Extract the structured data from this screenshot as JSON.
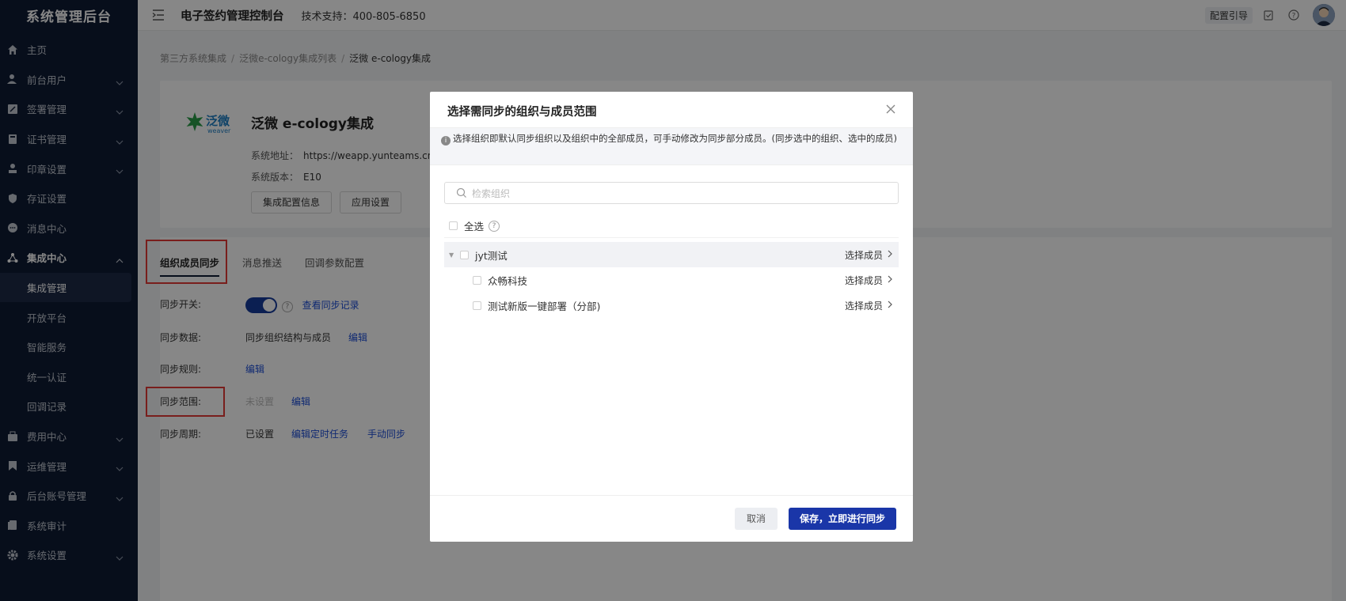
{
  "sidebar": {
    "brand": "系统管理后台",
    "items": [
      {
        "label": "主页",
        "icon": "home-icon",
        "chevron": false
      },
      {
        "label": "前台用户",
        "icon": "user-icon",
        "chevron": true
      },
      {
        "label": "签署管理",
        "icon": "sign-icon",
        "chevron": true
      },
      {
        "label": "证书管理",
        "icon": "certificate-icon",
        "chevron": true
      },
      {
        "label": "印章设置",
        "icon": "seal-icon",
        "chevron": true
      },
      {
        "label": "存证设置",
        "icon": "shield-icon",
        "chevron": false
      },
      {
        "label": "消息中心",
        "icon": "message-icon",
        "chevron": false
      },
      {
        "label": "集成中心",
        "icon": "integration-icon",
        "chevron": true,
        "expanded": true
      },
      {
        "label": "集成管理",
        "sub": true,
        "active": true
      },
      {
        "label": "开放平台",
        "sub": true
      },
      {
        "label": "智能服务",
        "sub": true
      },
      {
        "label": "统一认证",
        "sub": true
      },
      {
        "label": "回调记录",
        "sub": true
      },
      {
        "label": "费用中心",
        "icon": "wallet-icon",
        "chevron": true
      },
      {
        "label": "运维管理",
        "icon": "bookmark-icon",
        "chevron": true
      },
      {
        "label": "后台账号管理",
        "icon": "lock-icon",
        "chevron": true
      },
      {
        "label": "系统审计",
        "icon": "audit-icon",
        "chevron": false
      },
      {
        "label": "系统设置",
        "icon": "gear-icon",
        "chevron": true
      }
    ]
  },
  "header": {
    "title": "电子签约管理控制台",
    "support": "技术支持：400-805-6850",
    "guide": "配置引导"
  },
  "breadcrumb": [
    "第三方系统集成",
    "泛微e-cology集成列表",
    "泛微 e-cology集成"
  ],
  "app": {
    "logo_text": "泛微",
    "logo_sub": "weaver",
    "name": "泛微 e-cology集成",
    "address_label": "系统地址：",
    "address": "https://weapp.yunteams.cn",
    "version_label": "系统版本：",
    "version": "E10",
    "btn_config": "集成配置信息",
    "btn_app": "应用设置"
  },
  "tabs": [
    "组织成员同步",
    "消息推送",
    "回调参数配置"
  ],
  "settings": {
    "switch_label": "同步开关:",
    "view_records": "查看同步记录",
    "data_label": "同步数据:",
    "data_value": "同步组织结构与成员",
    "rule_label": "同步规则:",
    "range_label": "同步范围:",
    "range_value": "未设置",
    "cycle_label": "同步周期:",
    "cycle_value": "已设置",
    "edit": "编辑",
    "edit_timer": "编辑定时任务",
    "manual_sync": "手动同步"
  },
  "modal": {
    "title": "选择需同步的组织与成员范围",
    "notice": "选择组织即默认同步组织以及组织中的全部成员，可手动修改为同步部分成员。(同步选中的组织、选中的成员)",
    "search_placeholder": "检索组织",
    "select_all": "全选",
    "select_member": "选择成员",
    "tree": [
      {
        "label": "jyt测试",
        "level": 0
      },
      {
        "label": "众畅科技",
        "level": 1
      },
      {
        "label": "测试新版一键部署（分部)",
        "level": 1
      }
    ],
    "cancel": "取消",
    "save": "保存，立即进行同步"
  }
}
